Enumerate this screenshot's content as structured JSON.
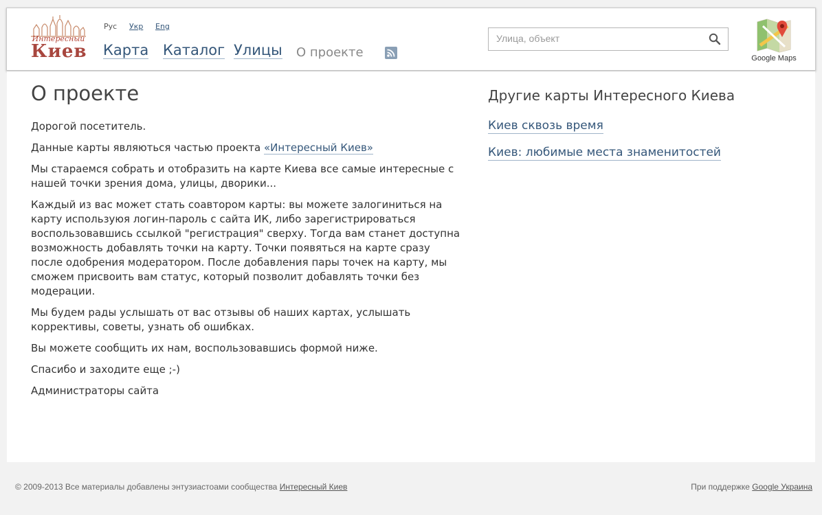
{
  "header": {
    "logo": {
      "text_small": "Интересный",
      "text_big": "Киев"
    },
    "languages": [
      {
        "label": "Рус",
        "active": true
      },
      {
        "label": "Укр",
        "active": false
      },
      {
        "label": "Eng",
        "active": false
      }
    ],
    "nav": [
      {
        "label": "Карта"
      },
      {
        "label": "Каталог"
      },
      {
        "label": "Улицы"
      },
      {
        "label": "О проекте",
        "active": true
      }
    ],
    "rss_icon": "rss-icon",
    "search": {
      "placeholder": "Улица, объект",
      "value": "",
      "icon": "search-icon"
    },
    "google_maps": {
      "label": "Google Maps",
      "icon": "google-maps-icon"
    }
  },
  "main": {
    "title": "О проекте",
    "paragraphs": [
      "Дорогой посетитель.",
      "Данные карты являються частью проекта ",
      "Мы стараемся собрать и отобразить на карте Киева все самые интересные с нашей точки зрения дома, улицы, дворики...",
      "Каждый из вас может стать соавтором карты: вы можете залогиниться на карту используюя логин-пароль с сайта ИК, либо зарегистрироваться воспользовавшись ссылкой \"регистрация\" сверху. Тогда вам станет доступна возможность добавлять точки на карту. Точки появяться на карте сразу после одобрения модератором. После добавления пары точек на карту, мы сможем присвоить вам статус, который позволит добавлять точки без модерации.",
      "Мы будем рады услышать от вас отзывы об наших картах, услышать коррективы, советы, узнать об ошибках.",
      "Вы можете сообщить их нам, воспользовавшись формой ниже.",
      "Спасибо и заходите еще ;-)",
      "Администраторы сайта"
    ],
    "project_link": "«Интересный Киев»"
  },
  "sidebar": {
    "title": "Другие карты Интересного Киева",
    "links": [
      "Киев сквозь время",
      "Киев: любимые места знаменитостей"
    ]
  },
  "footer": {
    "left_text": "© 2009-2013 Все материалы добавлены энтузиастоами сообщества ",
    "left_link": "Интересный Киев",
    "right_text": "При поддержке ",
    "right_link": "Google Украина"
  },
  "colors": {
    "link": "#35577a",
    "logo": "#a8463e",
    "page_bg": "#f2f2f2"
  }
}
